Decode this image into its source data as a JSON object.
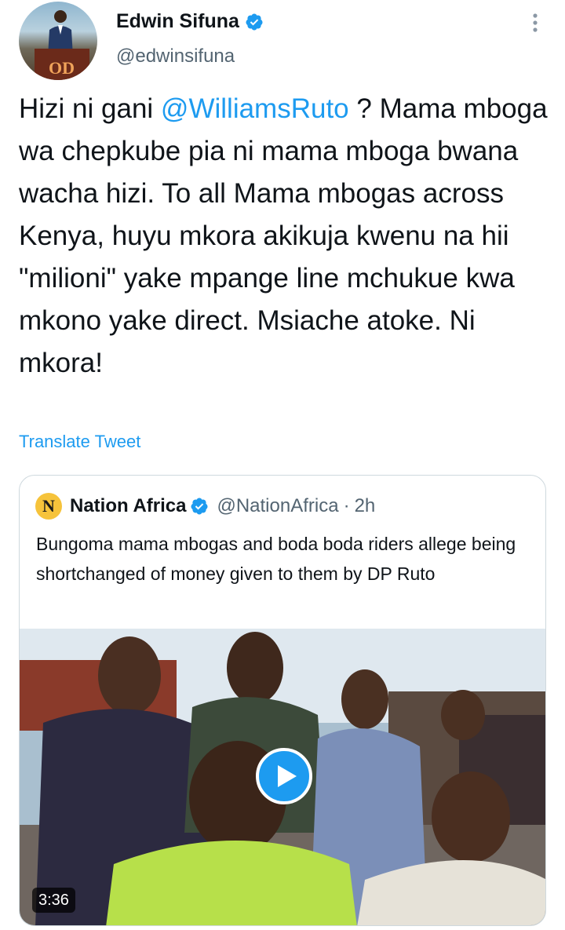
{
  "author": {
    "display_name": "Edwin Sifuna",
    "handle": "@edwinsifuna",
    "avatar_text": "OD",
    "verified_icon": "verified-badge-icon"
  },
  "tweet": {
    "text_before_mention": "Hizi ni gani ",
    "mention": "@WilliamsRuto",
    "text_after_mention": " ? Mama mboga wa chepkube pia ni mama mboga bwana wacha hizi. To all Mama mbogas across Kenya, huyu mkora akikuja kwenu na hii \"milioni\" yake mpange line mchukue kwa mkono yake direct. Msiache atoke. Ni mkora!",
    "translate_label": "Translate Tweet"
  },
  "quoted_tweet": {
    "logo_letter": "N",
    "display_name": "Nation Africa",
    "handle": "@NationAfrica",
    "separator": "·",
    "time": "2h",
    "text": "Bungoma mama mbogas and boda boda riders allege being shortchanged of money given to them by DP Ruto",
    "video": {
      "duration": "3:36",
      "play_icon": "play-icon"
    }
  },
  "colors": {
    "accent": "#1d9bf0",
    "text_primary": "#0f1419",
    "text_secondary": "#536471",
    "border": "#cfd9de"
  }
}
